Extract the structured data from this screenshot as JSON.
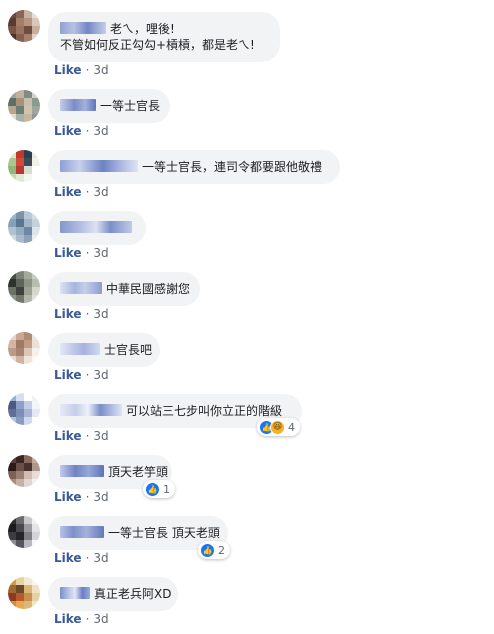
{
  "comments": [
    {
      "text_line1": "老ㄟ，哩後!",
      "text_line2": "不管如何反正勾勾+槓槓，都是老ㄟ!",
      "like": "Like",
      "dot": "·",
      "time": "3d"
    },
    {
      "text": "一等士官長",
      "like": "Like",
      "dot": "·",
      "time": "3d"
    },
    {
      "text": "一等士官長，連司令都要跟他敬禮",
      "like": "Like",
      "dot": "·",
      "time": "3d"
    },
    {
      "text": "",
      "like": "Like",
      "dot": "·",
      "time": "3d"
    },
    {
      "text": "中華民國感謝您",
      "like": "Like",
      "dot": "·",
      "time": "3d"
    },
    {
      "text": "士官長吧",
      "like": "Like",
      "dot": "·",
      "time": "3d"
    },
    {
      "text": "可以站三七步叫你立正的階級",
      "like": "Like",
      "dot": "·",
      "time": "3d",
      "reaction_count": "4",
      "reaction_icons": [
        "like-icon",
        "haha-icon"
      ]
    },
    {
      "text": "頂天老竽頭",
      "like": "Like",
      "dot": "·",
      "time": "3d",
      "reaction_count": "1",
      "reaction_icons": [
        "like-icon"
      ]
    },
    {
      "text": "一等士官長 頂天老頭",
      "like": "Like",
      "dot": "·",
      "time": "3d",
      "reaction_count": "2",
      "reaction_icons": [
        "like-icon"
      ]
    },
    {
      "text": "真正老兵阿XD",
      "like": "Like",
      "dot": "·",
      "time": "3d"
    }
  ],
  "colors": {
    "bubble": "#f2f3f5",
    "link": "#385898",
    "meta": "#606770",
    "like_reaction": "#1877f2",
    "haha_reaction": "#f7b125"
  }
}
